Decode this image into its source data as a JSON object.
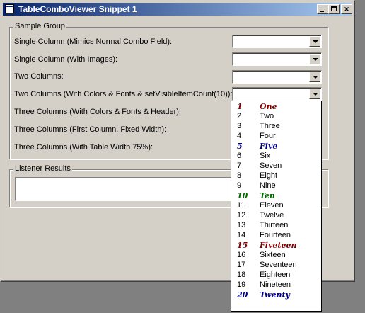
{
  "window": {
    "title": "TableComboViewer Snippet 1",
    "close_glyph": "×"
  },
  "sample_group": {
    "legend": "Sample Group",
    "rows": [
      {
        "label": "Single Column (Mimics Normal Combo Field):",
        "value": ""
      },
      {
        "label": "Single Column (With Images):",
        "value": ""
      },
      {
        "label": "Two Columns:",
        "value": ""
      },
      {
        "label": "Two Columns (With Colors & Fonts & setVisibleItemCount(10)):",
        "value": ""
      },
      {
        "label": "Three Columns (With Colors & Fonts & Header):",
        "value": ""
      },
      {
        "label": "Three Columns (First Column, Fixed Width):",
        "value": ""
      },
      {
        "label": "Three Columns (With Table Width 75%):",
        "value": ""
      }
    ]
  },
  "listener_group": {
    "legend": "Listener Results",
    "value": ""
  },
  "dropdown": {
    "items": [
      {
        "num": "1",
        "word": "One",
        "color": "#800000",
        "styled": true
      },
      {
        "num": "2",
        "word": "Two",
        "color": "#000000",
        "styled": false
      },
      {
        "num": "3",
        "word": "Three",
        "color": "#000000",
        "styled": false
      },
      {
        "num": "4",
        "word": "Four",
        "color": "#000000",
        "styled": false
      },
      {
        "num": "5",
        "word": "Five",
        "color": "#000080",
        "styled": true
      },
      {
        "num": "6",
        "word": "Six",
        "color": "#000000",
        "styled": false
      },
      {
        "num": "7",
        "word": "Seven",
        "color": "#000000",
        "styled": false
      },
      {
        "num": "8",
        "word": "Eight",
        "color": "#000000",
        "styled": false
      },
      {
        "num": "9",
        "word": "Nine",
        "color": "#000000",
        "styled": false
      },
      {
        "num": "10",
        "word": "Ten",
        "color": "#006400",
        "styled": true
      },
      {
        "num": "11",
        "word": "Eleven",
        "color": "#000000",
        "styled": false
      },
      {
        "num": "12",
        "word": "Twelve",
        "color": "#000000",
        "styled": false
      },
      {
        "num": "13",
        "word": "Thirteen",
        "color": "#000000",
        "styled": false
      },
      {
        "num": "14",
        "word": "Fourteen",
        "color": "#000000",
        "styled": false
      },
      {
        "num": "15",
        "word": "Fiveteen",
        "color": "#800000",
        "styled": true
      },
      {
        "num": "16",
        "word": "Sixteen",
        "color": "#000000",
        "styled": false
      },
      {
        "num": "17",
        "word": "Seventeen",
        "color": "#000000",
        "styled": false
      },
      {
        "num": "18",
        "word": "Eighteen",
        "color": "#000000",
        "styled": false
      },
      {
        "num": "19",
        "word": "Nineteen",
        "color": "#000000",
        "styled": false
      },
      {
        "num": "20",
        "word": "Twenty",
        "color": "#000080",
        "styled": true
      }
    ]
  }
}
